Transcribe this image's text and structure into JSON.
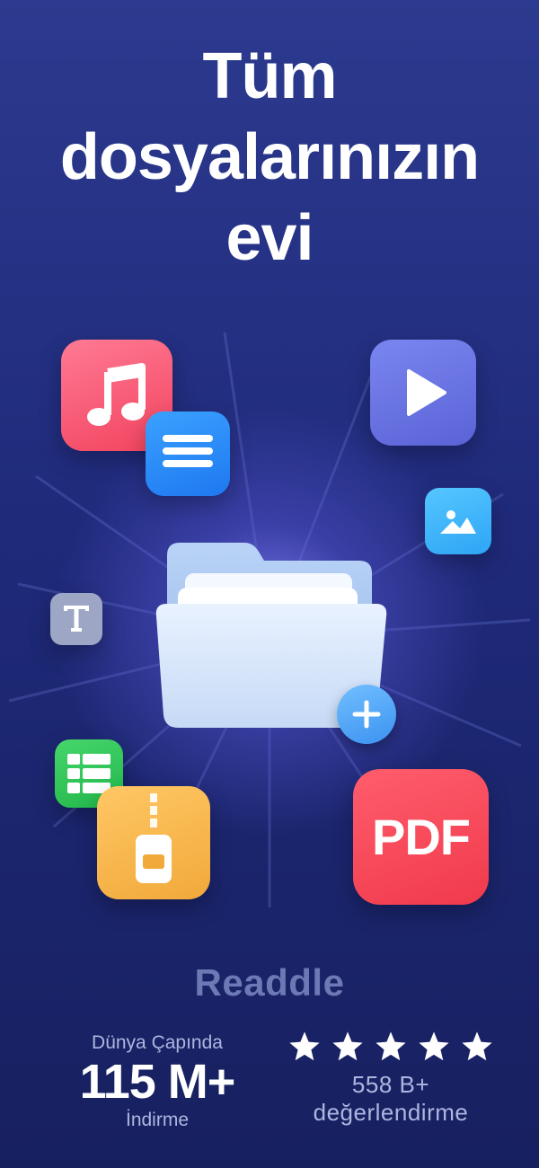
{
  "headline": {
    "line1": "Tüm",
    "line2": "dosyalarınızın",
    "line3": "evi"
  },
  "icons": {
    "music": "music-note-icon",
    "document": "document-lines-icon",
    "video": "play-icon",
    "image": "image-mountain-icon",
    "text": "text-t-icon",
    "spreadsheet": "spreadsheet-grid-icon",
    "archive": "zip-archive-icon",
    "pdf": "pdf-icon",
    "folder": "folder-icon",
    "plus": "plus-icon"
  },
  "pdf_label": "PDF",
  "brand": "Readdle",
  "stats": {
    "downloads": {
      "caption_top": "Dünya Çapında",
      "value": "115 M+",
      "caption_bottom": "İndirme"
    },
    "ratings": {
      "stars": 5,
      "value": "558 B+",
      "caption": "değerlendirme"
    }
  },
  "colors": {
    "background_top": "#2c3a8f",
    "background_bottom": "#17205f",
    "music": "#f2435f",
    "document": "#1e78f0",
    "video": "#5a63d6",
    "image": "#2ea5f5",
    "text": "#9ea6c6",
    "spreadsheet": "#22b64a",
    "archive": "#f1a93a",
    "pdf": "#f03a4c"
  }
}
